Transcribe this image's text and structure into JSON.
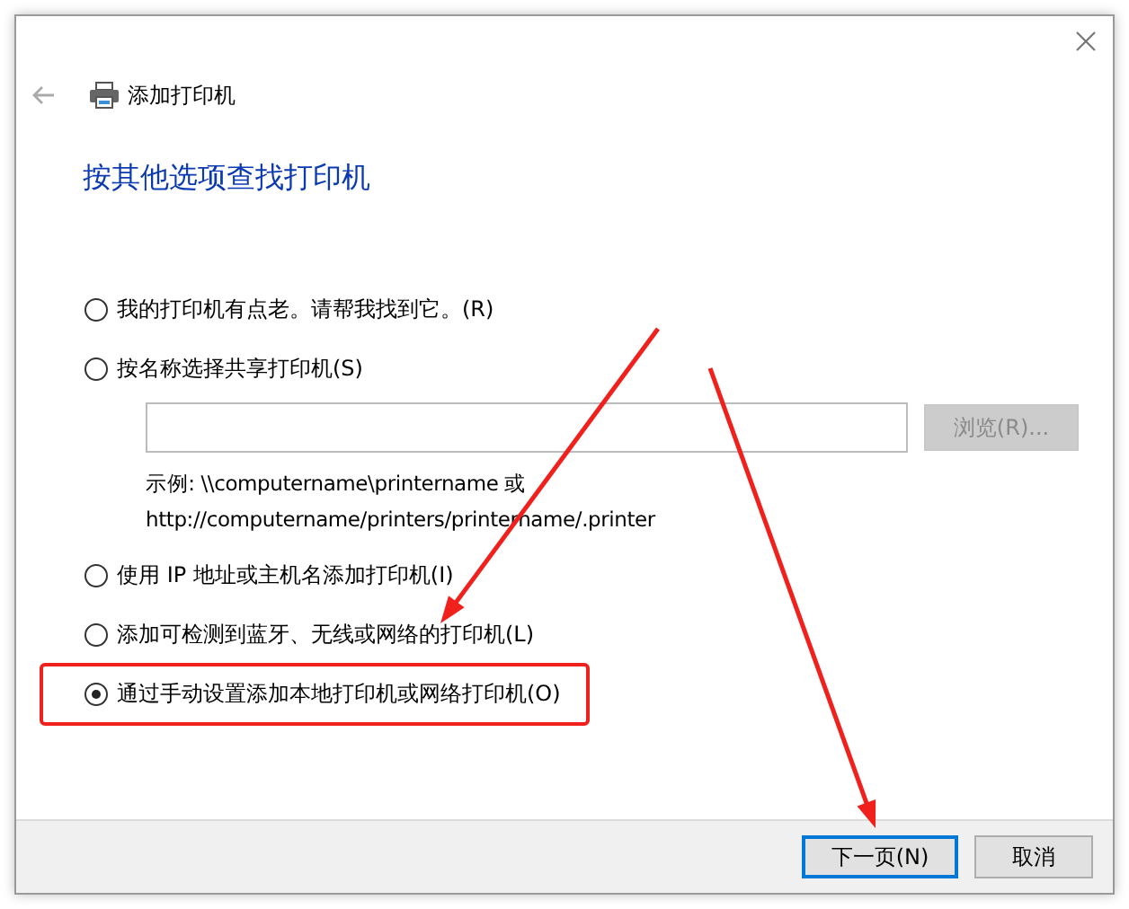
{
  "window": {
    "title": "添加打印机"
  },
  "heading": "按其他选项查找打印机",
  "options": [
    {
      "label": "我的打印机有点老。请帮我找到它。(R)",
      "selected": false,
      "highlighted": false
    },
    {
      "label": "按名称选择共享打印机(S)",
      "selected": false,
      "highlighted": false
    },
    {
      "label": "使用 IP 地址或主机名添加打印机(I)",
      "selected": false,
      "highlighted": false
    },
    {
      "label": "添加可检测到蓝牙、无线或网络的打印机(L)",
      "selected": false,
      "highlighted": false
    },
    {
      "label": "通过手动设置添加本地打印机或网络打印机(O)",
      "selected": true,
      "highlighted": true
    }
  ],
  "share_browse": {
    "label": "浏览(R)...",
    "disabled": true
  },
  "example_lines": [
    "示例: \\\\computername\\printername 或",
    "http://computername/printers/printername/.printer"
  ],
  "buttons": [
    {
      "label": "下一页(N)",
      "default": true
    },
    {
      "label": "取消",
      "default": false
    }
  ]
}
